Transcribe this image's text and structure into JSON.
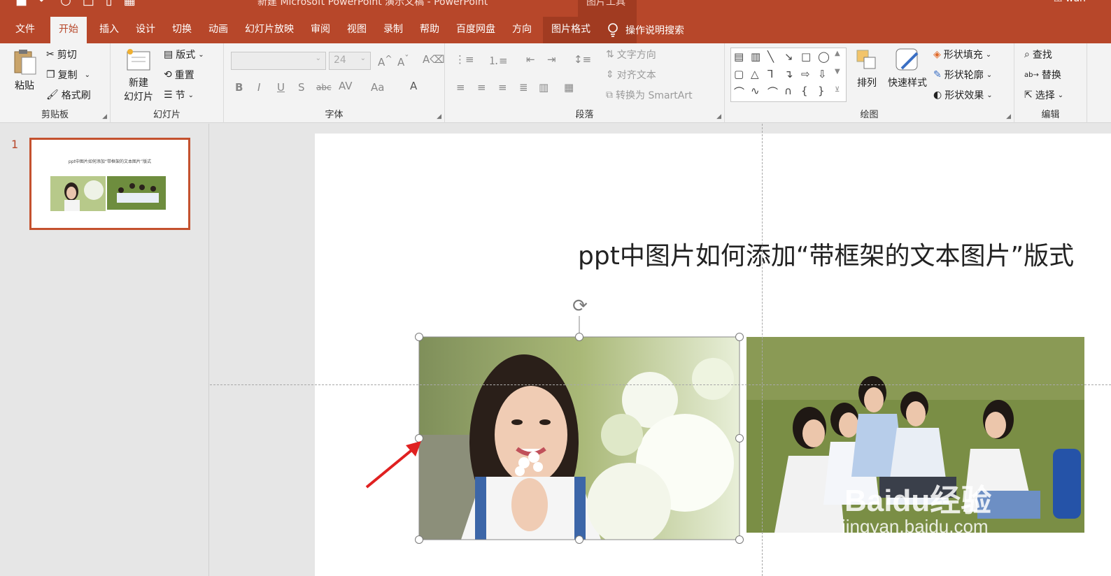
{
  "window": {
    "title": "新建 Microsoft PowerPoint 演示文稿 - PowerPoint",
    "picture_tools": "图片工具",
    "user": "wan"
  },
  "tabs": [
    {
      "label": "文件"
    },
    {
      "label": "开始"
    },
    {
      "label": "插入"
    },
    {
      "label": "设计"
    },
    {
      "label": "切换"
    },
    {
      "label": "动画"
    },
    {
      "label": "幻灯片放映"
    },
    {
      "label": "审阅"
    },
    {
      "label": "视图"
    },
    {
      "label": "录制"
    },
    {
      "label": "帮助"
    },
    {
      "label": "百度网盘"
    },
    {
      "label": "方向"
    },
    {
      "label": "图片格式"
    }
  ],
  "search_tab": "操作说明搜索",
  "ribbon": {
    "clipboard": {
      "label": "剪贴板",
      "paste": "粘贴",
      "cut": "剪切",
      "copy": "复制",
      "format_painter": "格式刷"
    },
    "slides": {
      "label": "幻灯片",
      "new_slide_1": "新建",
      "new_slide_2": "幻灯片",
      "layout": "版式",
      "reset": "重置",
      "section": "节"
    },
    "font": {
      "label": "字体",
      "font_size": "24"
    },
    "paragraph": {
      "label": "段落",
      "text_direction": "文字方向",
      "align_text": "对齐文本",
      "smartart": "转换为 SmartArt"
    },
    "drawing": {
      "label": "绘图",
      "arrange": "排列",
      "quick_styles": "快速样式",
      "shape_fill": "形状填充",
      "shape_outline": "形状轮廓",
      "shape_effects": "形状效果"
    },
    "editing": {
      "label": "编辑",
      "find": "查找",
      "replace": "替换",
      "select": "选择"
    }
  },
  "thumbnails": [
    {
      "number": "1",
      "title": "ppt中图片如何添加“带框架的文本图片”版式"
    }
  ],
  "slide": {
    "title": "ppt中图片如何添加“带框架的文本图片”版式"
  },
  "watermark": {
    "brand": "Baidu经验",
    "url": "jingyan.baidu.com"
  },
  "colors": {
    "accent": "#b7472a",
    "arrow": "#e02020"
  }
}
